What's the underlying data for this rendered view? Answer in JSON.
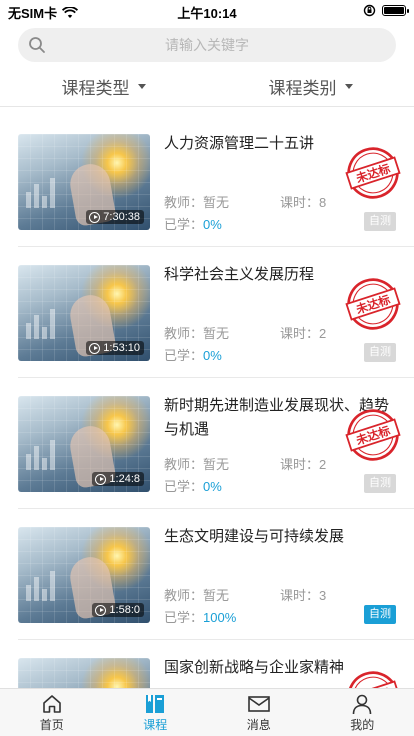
{
  "status_bar": {
    "carrier": "无SIM卡",
    "time": "上午10:14"
  },
  "search": {
    "placeholder": "请输入关键字"
  },
  "filters": [
    {
      "label": "课程类型"
    },
    {
      "label": "课程类别"
    }
  ],
  "labels": {
    "teacher_prefix": "教师：",
    "hours_prefix": "课时：",
    "progress_prefix": "已学：",
    "stamp_text": "未达标"
  },
  "courses": [
    {
      "title": "人力资源管理二十五讲",
      "teacher": "暂无",
      "hours": "8",
      "progress": "0%",
      "duration": "7:30:38",
      "quiz": "自测",
      "quiz_enabled": false,
      "stamp": true
    },
    {
      "title": "科学社会主义发展历程",
      "teacher": "暂无",
      "hours": "2",
      "progress": "0%",
      "duration": "1:53:10",
      "quiz": "自测",
      "quiz_enabled": false,
      "stamp": true
    },
    {
      "title": "新时期先进制造业发展现状、趋势与机遇",
      "teacher": "暂无",
      "hours": "2",
      "progress": "0%",
      "duration": "1:24:8",
      "quiz": "自测",
      "quiz_enabled": false,
      "stamp": true
    },
    {
      "title": "生态文明建设与可持续发展",
      "teacher": "暂无",
      "hours": "3",
      "progress": "100%",
      "duration": "1:58:0",
      "quiz": "自测",
      "quiz_enabled": true,
      "stamp": false
    },
    {
      "title": "国家创新战略与企业家精神",
      "teacher": "",
      "hours": "",
      "progress": "",
      "duration": "",
      "quiz": "",
      "quiz_enabled": false,
      "stamp": true
    }
  ],
  "tabbar": [
    {
      "label": "首页",
      "icon": "home-icon"
    },
    {
      "label": "课程",
      "icon": "book-icon",
      "active": true
    },
    {
      "label": "消息",
      "icon": "mail-icon"
    },
    {
      "label": "我的",
      "icon": "person-icon"
    }
  ],
  "colors": {
    "accent": "#1a9fd6",
    "stamp": "#d9242b"
  }
}
